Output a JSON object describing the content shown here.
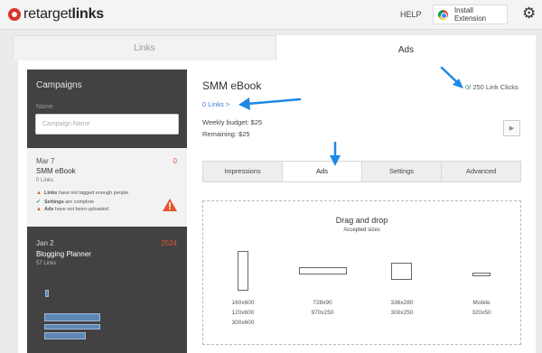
{
  "topbar": {
    "logo_plain": "retarget",
    "logo_bold": "links",
    "help": "HELP",
    "install_extension": "Install Extension"
  },
  "tabs": {
    "links": "Links",
    "ads": "Ads"
  },
  "sidebar": {
    "title": "Campaigns",
    "name_label": "Name",
    "name_placeholder": "Campaign Name",
    "campaigns": [
      {
        "date": "Mar 7",
        "count": "0",
        "title": "SMM eBook",
        "links": "0 Links",
        "statuses": [
          {
            "icon": "warning-icon",
            "bold": "Links",
            "text": " have not tagged enough people"
          },
          {
            "icon": "check-icon",
            "bold": "Settings",
            "text": " are complete"
          },
          {
            "icon": "warning-icon",
            "bold": "Ads",
            "text": " have not been uploaded"
          }
        ]
      },
      {
        "date": "Jan 2",
        "count": "2524",
        "title": "Blogging Planner",
        "links": "57 Links"
      }
    ]
  },
  "main": {
    "campaign_name": "SMM eBook",
    "links_link": "0 Links >",
    "weekly_budget": "Weekly budget: $25",
    "remaining": "Remaining: $25",
    "clicks_zero": "0",
    "clicks_rest": "/ 250 Link Clicks",
    "subtabs": [
      "Impressions",
      "Ads",
      "Settings",
      "Advanced"
    ],
    "active_subtab": "Ads",
    "dropzone": {
      "title": "Drag and drop",
      "subtitle": "Accepted sizes",
      "sizes": [
        {
          "lines": [
            "160x600",
            "120x600",
            "300x600"
          ]
        },
        {
          "lines": [
            "728x90",
            "970x250"
          ]
        },
        {
          "lines": [
            "336x280",
            "300x250"
          ]
        },
        {
          "lines": [
            "Mobile",
            "320x50"
          ]
        }
      ]
    }
  },
  "colors": {
    "accent_red": "#d9342b",
    "count_orange": "#e2542f",
    "link_blue": "#3c7bd1",
    "annotation_blue": "#1e88e5",
    "sidebar_dark": "#424242",
    "success_green": "#28a745"
  }
}
